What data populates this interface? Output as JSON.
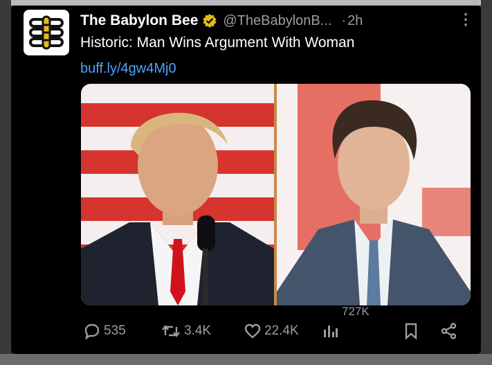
{
  "tweet": {
    "author_name": "The Babylon Bee",
    "handle": "@TheBabylonB...",
    "separator": "·",
    "time": "2h",
    "headline": "Historic: Man Wins Argument With Woman",
    "link": "buff.ly/4gw4Mj0",
    "views_overlay": "727K"
  },
  "actions": {
    "replies": "535",
    "reposts": "3.4K",
    "likes": "22.4K"
  },
  "icons": {
    "avatar": "babylon-bee-logo-icon",
    "verified": "verified-badge-icon",
    "more": "more-options-icon",
    "reply": "reply-icon",
    "repost": "repost-icon",
    "like": "heart-icon",
    "views": "views-chart-icon",
    "bookmark": "bookmark-icon",
    "share": "share-icon"
  },
  "colors": {
    "background": "#000000",
    "link": "#4ea3ff",
    "verified_gold": "#e2b719",
    "muted": "#9a9ea3"
  }
}
